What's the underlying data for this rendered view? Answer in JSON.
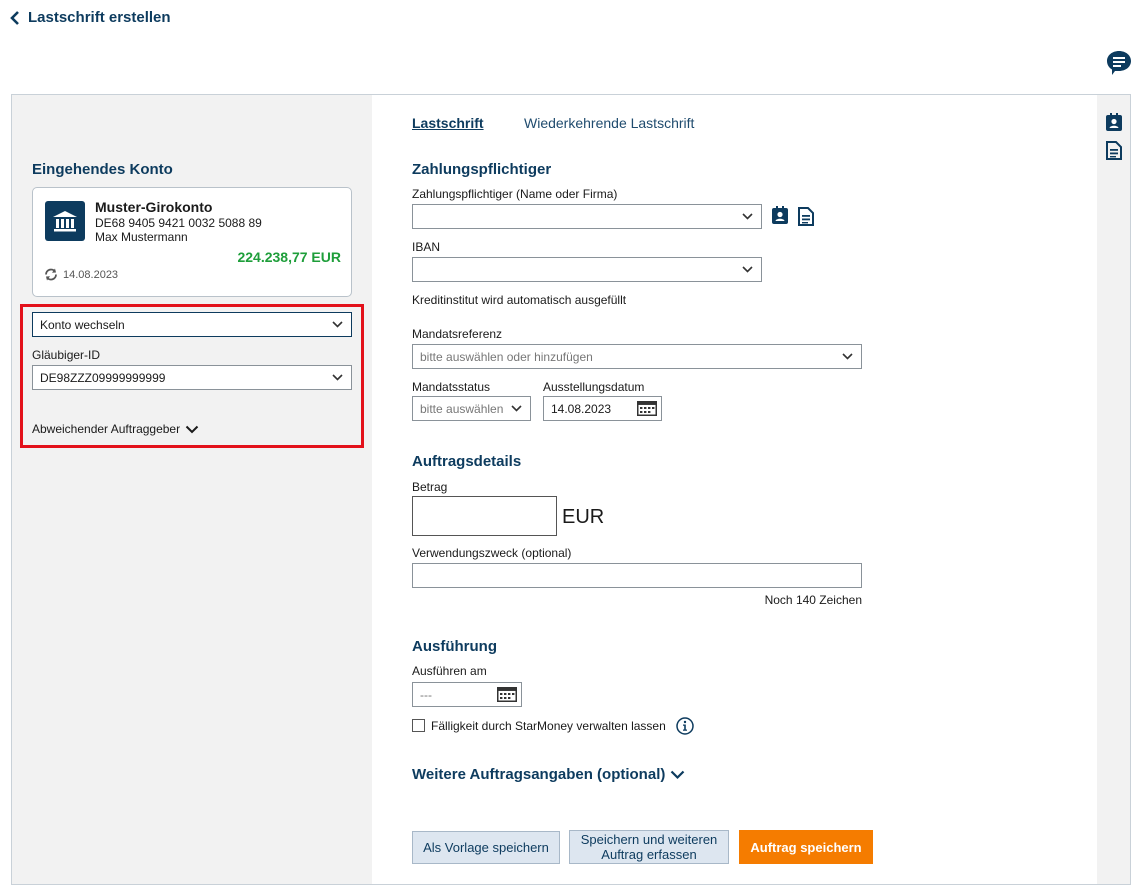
{
  "header": {
    "back_title": "Lastschrift erstellen"
  },
  "left": {
    "section_title": "Eingehendes Konto",
    "account": {
      "name": "Muster-Girokonto",
      "iban": "DE68 9405 9421 0032 5088 89",
      "owner": "Max Mustermann",
      "balance": "224.238,77 EUR",
      "date": "14.08.2023"
    },
    "switch_account": "Konto wechseln",
    "creditor_label": "Gläubiger-ID",
    "creditor_value": "DE98ZZZ09999999999",
    "other_principal": "Abweichender Auftraggeber"
  },
  "tabs": [
    {
      "label": "Lastschrift"
    },
    {
      "label": "Wiederkehrende Lastschrift"
    }
  ],
  "payer": {
    "title": "Zahlungspflichtiger",
    "name_label": "Zahlungspflichtiger (Name oder Firma)",
    "name_value": "",
    "iban_label": "IBAN",
    "iban_value": "",
    "bank_note": "Kreditinstitut wird automatisch ausgefüllt",
    "mandate_ref_label": "Mandatsreferenz",
    "mandate_ref_placeholder": "bitte auswählen oder hinzufügen",
    "mandate_status_label": "Mandatsstatus",
    "mandate_status_placeholder": "bitte auswählen",
    "issue_date_label": "Ausstellungsdatum",
    "issue_date_value": "14.08.2023"
  },
  "order": {
    "title": "Auftragsdetails",
    "amount_label": "Betrag",
    "amount_value": "",
    "currency": "EUR",
    "purpose_label": "Verwendungszweck (optional)",
    "purpose_value": "",
    "chars_left": "Noch 140 Zeichen"
  },
  "execution": {
    "title": "Ausführung",
    "execute_label": "Ausführen am",
    "execute_placeholder": "---",
    "due_checkbox_label": "Fälligkeit durch StarMoney verwalten lassen"
  },
  "more": {
    "title": "Weitere Auftragsangaben (optional)"
  },
  "buttons": {
    "save_template": "Als Vorlage speichern",
    "save_and_new_1": "Speichern und weiteren",
    "save_and_new_2": "Auftrag erfassen",
    "save_order": "Auftrag speichern"
  },
  "colors": {
    "navy": "#0d3b5e",
    "balance_green": "#1e9e3a",
    "highlight_red": "#e3111b",
    "primary_orange": "#f57c00"
  }
}
